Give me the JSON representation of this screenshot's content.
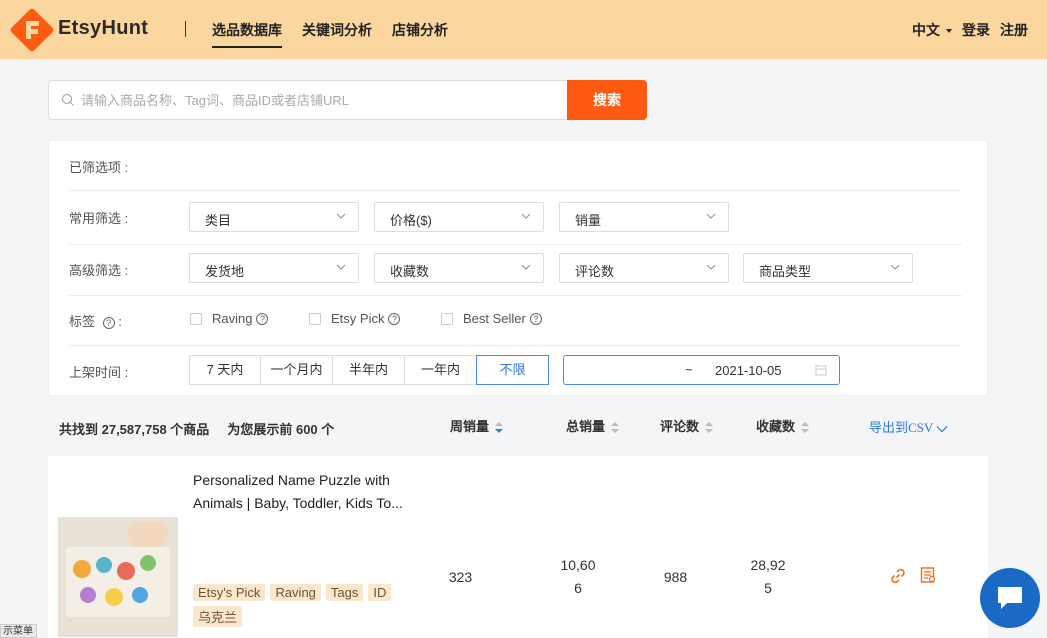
{
  "brand": {
    "name": "EtsyHunt"
  },
  "nav": {
    "items": [
      "选品数据库",
      "关键词分析",
      "店铺分析"
    ]
  },
  "top_right": {
    "language": "中文",
    "login": "登录",
    "register": "注册"
  },
  "search": {
    "placeholder": "请输入商品名称、Tag词、商品ID或者店铺URL",
    "button": "搜索"
  },
  "filters": {
    "selected_label": "已筛选项 :",
    "common_label": "常用筛选 :",
    "common": [
      "类目",
      "价格($)",
      "销量"
    ],
    "advanced_label": "高级筛选 :",
    "advanced": [
      "发货地",
      "收藏数",
      "评论数",
      "商品类型"
    ],
    "tags_label": "标签",
    "tags_colon": ":",
    "tag_options": [
      "Raving",
      "Etsy Pick",
      "Best Seller"
    ],
    "listed_label": "上架时间 :",
    "time_options": [
      "7 天内",
      "一个月内",
      "半年内",
      "一年内",
      "不限"
    ],
    "date_sep": "~",
    "date_end": "2021-10-05"
  },
  "results": {
    "found": "共找到 27,587,758 个商品",
    "showing": "为您展示前 600 个",
    "columns": [
      "周销量",
      "总销量",
      "评论数",
      "收藏数"
    ],
    "export": "导出到CSV"
  },
  "product": {
    "title": "Personalized Name Puzzle with Animals | Baby, Toddler, Kids To...",
    "tags": [
      "Etsy's Pick",
      "Raving",
      "Tags",
      "ID",
      "乌克兰"
    ],
    "weekly_sales": "323",
    "total_sales": "10,606",
    "reviews": "988",
    "favorites": "28,925"
  },
  "side_tab": {
    "label": "示菜单"
  },
  "colors": {
    "topbar": "#fbd69e",
    "accent": "#ff5a12",
    "link": "#2d7be0",
    "chat": "#1a69c4",
    "tag_bg": "#fbe7cc"
  }
}
